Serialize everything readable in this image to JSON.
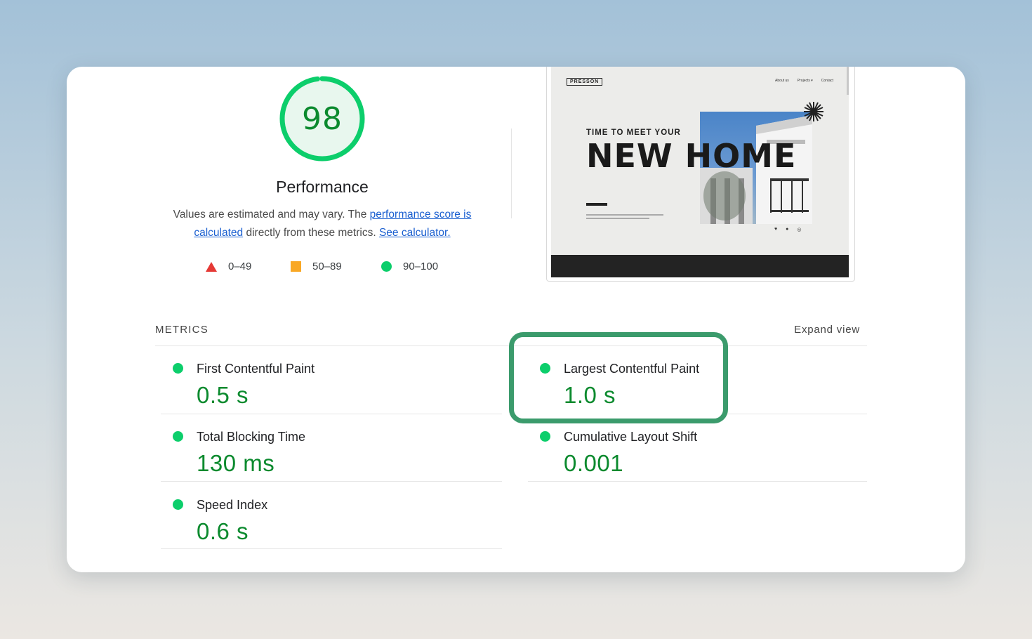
{
  "performance": {
    "score": "98",
    "score_fraction": 0.98,
    "title": "Performance",
    "description_prefix": "Values are estimated and may vary. The ",
    "score_link": "performance score is calculated",
    "description_middle": " directly from these metrics. ",
    "calculator_link": "See calculator."
  },
  "legend": [
    {
      "icon": "red-triangle-icon",
      "label": "0–49",
      "color": "#e53935"
    },
    {
      "icon": "orange-square-icon",
      "label": "50–89",
      "color": "#f9a825"
    },
    {
      "icon": "green-circle-icon",
      "label": "90–100",
      "color": "#0cce6b"
    }
  ],
  "screenshot": {
    "logo": "PRESSON",
    "nav": [
      "About us",
      "Projects ▾",
      "Contact"
    ],
    "kicker": "TIME TO MEET YOUR",
    "headline": "NEW HOME"
  },
  "metrics_header": {
    "label": "METRICS",
    "expand": "Expand view"
  },
  "metrics": [
    {
      "name": "First Contentful Paint",
      "value": "0.5 s"
    },
    {
      "name": "Largest Contentful Paint",
      "value": "1.0 s"
    },
    {
      "name": "Total Blocking Time",
      "value": "130 ms"
    },
    {
      "name": "Cumulative Layout Shift",
      "value": "0.001"
    },
    {
      "name": "Speed Index",
      "value": "0.6 s"
    }
  ],
  "colors": {
    "good": "#0cce6b",
    "good_text": "#0b8a2e",
    "gauge_fill": "#e8f7ee",
    "highlight": "#3b9b6c",
    "link": "#1a5fd0"
  }
}
